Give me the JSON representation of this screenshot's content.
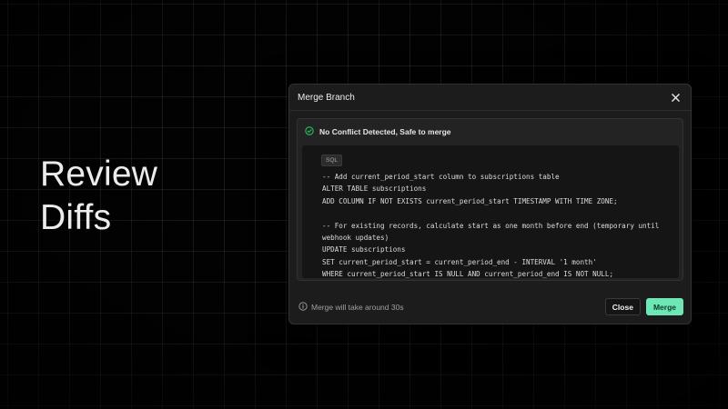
{
  "hero": {
    "line1": "Review",
    "line2": "Diffs"
  },
  "dialog": {
    "title": "Merge Branch",
    "close_icon": "close-icon",
    "status": {
      "icon": "check-circle-icon",
      "text": "No Conflict Detected, Safe to merge",
      "color": "#22c55e"
    },
    "code": {
      "language": "SQL",
      "lines": [
        "-- Add current_period_start column to subscriptions table",
        "ALTER TABLE subscriptions",
        "ADD COLUMN IF NOT EXISTS current_period_start TIMESTAMP WITH TIME ZONE;",
        "",
        "-- For existing records, calculate start as one month before end (temporary until",
        "webhook updates)",
        "UPDATE subscriptions",
        "SET current_period_start = current_period_end - INTERVAL '1 month'",
        "WHERE current_period_start IS NULL AND current_period_end IS NOT NULL;"
      ]
    },
    "footer": {
      "info_icon": "info-icon",
      "info_text": "Merge will take around 30s",
      "close_label": "Close",
      "merge_label": "Merge"
    }
  },
  "colors": {
    "accent": "#6ee7b7",
    "background": "#020202",
    "dialog": "#1c1c1c"
  }
}
